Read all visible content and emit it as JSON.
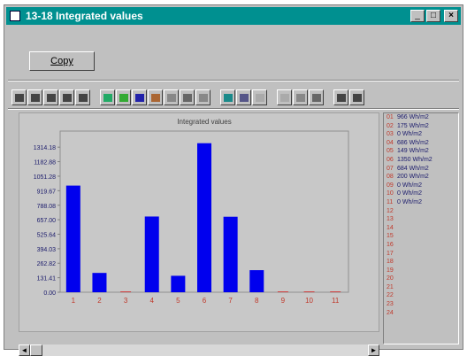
{
  "window": {
    "title": "13-18 Integrated values",
    "caption_buttons": {
      "minimize": "_",
      "maximize": "□",
      "close": "×"
    }
  },
  "copy_button": {
    "label": "Copy"
  },
  "toolbar": {
    "icons": [
      "save-icon",
      "print-icon",
      "export-icon",
      "cut-icon",
      "copy-icon",
      "area-chart-icon",
      "line-chart-icon",
      "bar-chart-icon",
      "pie-chart-icon",
      "step-chart-icon",
      "point-chart-icon",
      "3d-toggle-icon",
      "color-icon",
      "font-icon",
      "grid-icon",
      "legend-icon",
      "table-icon",
      "zoom-icon",
      "help-icon",
      "pointer-icon"
    ]
  },
  "chart_data": {
    "type": "bar",
    "title": "Integrated values",
    "categories": [
      "1",
      "2",
      "3",
      "4",
      "5",
      "6",
      "7",
      "8",
      "9",
      "10",
      "11"
    ],
    "values": [
      966,
      175,
      0,
      686,
      149,
      1350,
      684,
      200,
      0,
      0,
      0
    ],
    "ylim": [
      0,
      1460
    ],
    "yticks": [
      "1314.18",
      "1182.88",
      "1051.28",
      "919.67",
      "788.08",
      "657.00",
      "525.64",
      "394.03",
      "262.82",
      "131.41",
      "0.00"
    ],
    "bar_color": "#0000ee",
    "plot_bg": "#c8c8c8"
  },
  "list": {
    "rows": [
      {
        "n": "01",
        "v": "966 Wh/m2"
      },
      {
        "n": "02",
        "v": "175 Wh/m2"
      },
      {
        "n": "03",
        "v": "0 Wh/m2"
      },
      {
        "n": "04",
        "v": "686 Wh/m2"
      },
      {
        "n": "05",
        "v": "149 Wh/m2"
      },
      {
        "n": "06",
        "v": "1350 Wh/m2"
      },
      {
        "n": "07",
        "v": "684 Wh/m2"
      },
      {
        "n": "08",
        "v": "200 Wh/m2"
      },
      {
        "n": "09",
        "v": "0 Wh/m2"
      },
      {
        "n": "10",
        "v": "0 Wh/m2"
      },
      {
        "n": "11",
        "v": "0 Wh/m2"
      },
      {
        "n": "12",
        "v": ""
      },
      {
        "n": "13",
        "v": ""
      },
      {
        "n": "14",
        "v": ""
      },
      {
        "n": "15",
        "v": ""
      },
      {
        "n": "16",
        "v": ""
      },
      {
        "n": "17",
        "v": ""
      },
      {
        "n": "18",
        "v": ""
      },
      {
        "n": "19",
        "v": ""
      },
      {
        "n": "20",
        "v": ""
      },
      {
        "n": "21",
        "v": ""
      },
      {
        "n": "22",
        "v": ""
      },
      {
        "n": "23",
        "v": ""
      },
      {
        "n": "24",
        "v": ""
      }
    ]
  },
  "scrollbar": {
    "left_arrow": "◄",
    "right_arrow": "►"
  }
}
